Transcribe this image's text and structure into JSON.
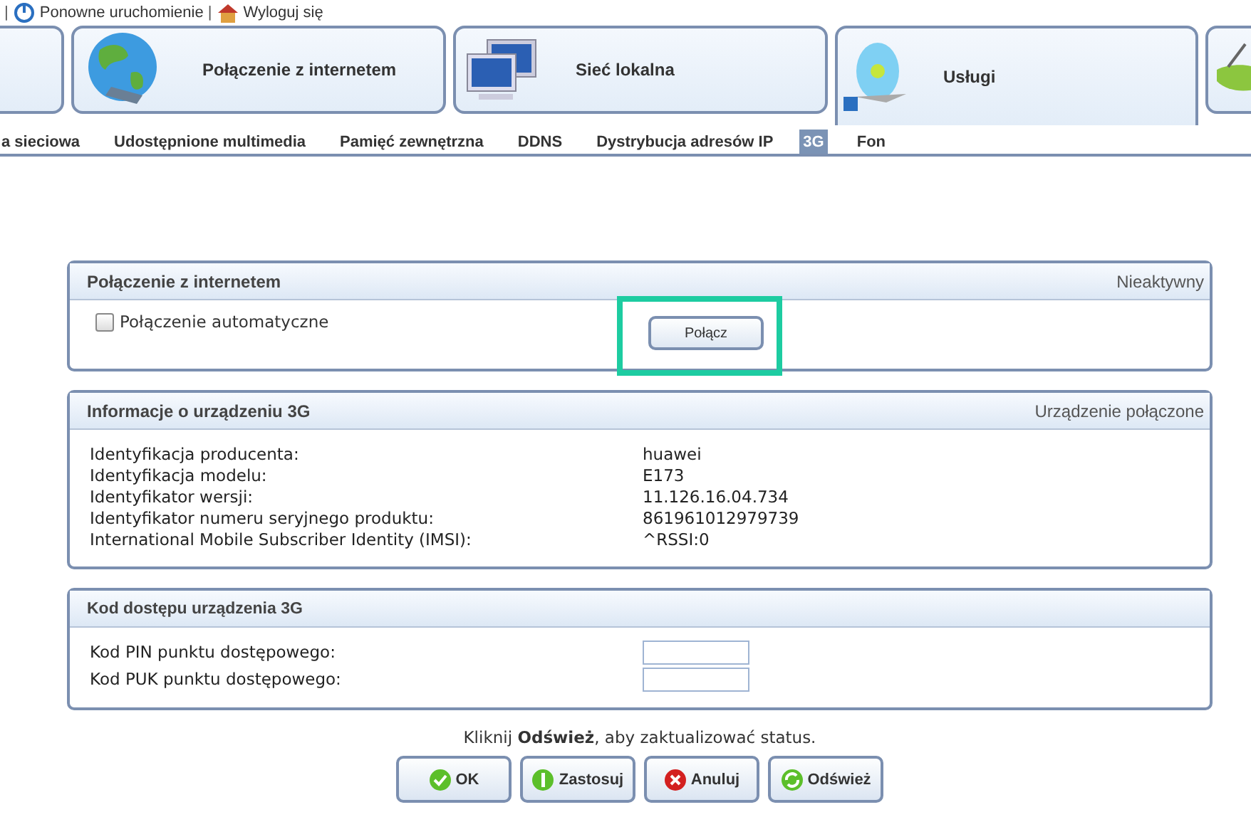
{
  "top_links": [
    {
      "separator": "|",
      "label": "Ponowne uruchomienie"
    },
    {
      "separator": "|",
      "label": "Wyloguj się"
    }
  ],
  "main_tabs": [
    {
      "kind": "partial",
      "selected": false
    },
    {
      "kind": "full",
      "label": "Połączenie z internetem",
      "selected": false
    },
    {
      "kind": "full",
      "label": "Sieć lokalna",
      "selected": false
    },
    {
      "kind": "full",
      "label": "Usługi",
      "selected": true
    },
    {
      "kind": "partial",
      "selected": false
    }
  ],
  "sub_tabs": [
    {
      "label": "a sieciowa",
      "selected": false
    },
    {
      "label": "Udostępnione multimedia",
      "selected": false
    },
    {
      "label": "Pamięć zewnętrzna",
      "selected": false
    },
    {
      "label": "DDNS",
      "selected": false
    },
    {
      "label": "Dystrybucja adresów IP",
      "selected": false
    },
    {
      "label": "3G",
      "selected": true
    },
    {
      "label": "Fon",
      "selected": false
    }
  ],
  "connection": {
    "title": "Połączenie z internetem",
    "status": "Nieaktywny",
    "checkbox": {
      "label": "Połączenie automatyczne",
      "checked": false
    },
    "button": "Połącz"
  },
  "device_info": {
    "title": "Informacje o urządzeniu 3G",
    "status": "Urządzenie połączone",
    "rows": [
      {
        "label": "Identyfikacja producenta:",
        "value": "huawei"
      },
      {
        "label": "Identyfikacja modelu:",
        "value": "E173"
      },
      {
        "label": "Identyfikator wersji:",
        "value": "11.126.16.04.734"
      },
      {
        "label": "Identyfikator numeru seryjnego produktu:",
        "value": "861961012979739"
      },
      {
        "label": "International Mobile Subscriber Identity (IMSI):",
        "value": "^RSSI:0"
      }
    ]
  },
  "access_code": {
    "title": "Kod dostępu urządzenia 3G",
    "fields": [
      {
        "label": "Kod PIN punktu dostępowego:"
      },
      {
        "label": "Kod PUK punktu dostępowego:"
      }
    ]
  },
  "message": "Kliknij **Odśwież**, aby zaktualizować status.",
  "buttons": [
    {
      "label": "OK"
    },
    {
      "label": "Zastosuj"
    },
    {
      "label": "Anuluj"
    },
    {
      "label": "Odśwież"
    }
  ]
}
